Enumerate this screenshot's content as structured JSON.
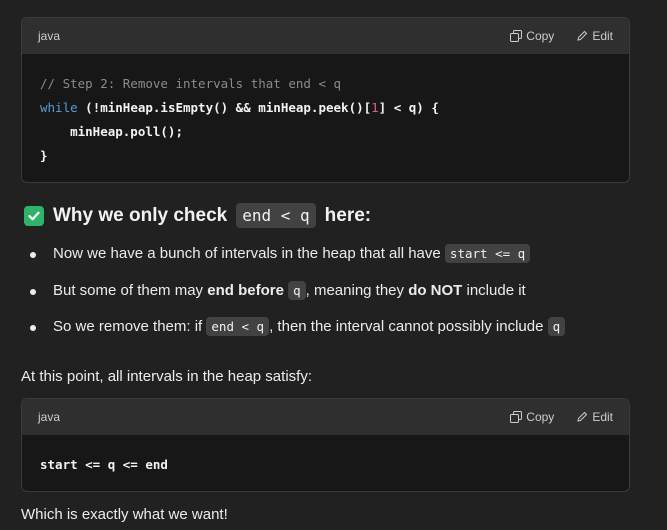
{
  "code_block_1": {
    "language": "java",
    "copy_label": "Copy",
    "edit_label": "Edit",
    "lines": {
      "l1": "// Step 2: Remove intervals that end < q",
      "l2_kw": "while",
      "l2_a": " (!minHeap.isEmpty() && minHeap.peek()[",
      "l2_num": "1",
      "l2_b": "] < q) {",
      "l3": "    minHeap.poll();",
      "l4": "}"
    }
  },
  "heading": {
    "icon": "check-mark-button-icon",
    "pre": "Why we only check",
    "code": "end < q",
    "post": "here:"
  },
  "bullets": {
    "b1": {
      "text": "Now we have a bunch of intervals in the heap that all have",
      "code": "start <= q"
    },
    "b2": {
      "t1": "But some of them may ",
      "strong1": "end before",
      "code": "q",
      "t2": ", meaning they ",
      "strong2": "do NOT",
      "t3": " include it"
    },
    "b3": {
      "t1": "So we remove them: if ",
      "code1": "end < q",
      "t2": ", then the interval cannot possibly include ",
      "code2": "q"
    }
  },
  "paragraph_1": "At this point, all intervals in the heap satisfy:",
  "code_block_2": {
    "language": "java",
    "copy_label": "Copy",
    "edit_label": "Edit",
    "line": "start <= q <= end"
  },
  "paragraph_2": "Which is exactly what we want!",
  "colors": {
    "background": "#212121",
    "code_bg": "#171717",
    "header_bg": "#2f2f2f",
    "check": "#2fb36b",
    "keyword": "#569cd6",
    "number": "#e05d8a"
  }
}
